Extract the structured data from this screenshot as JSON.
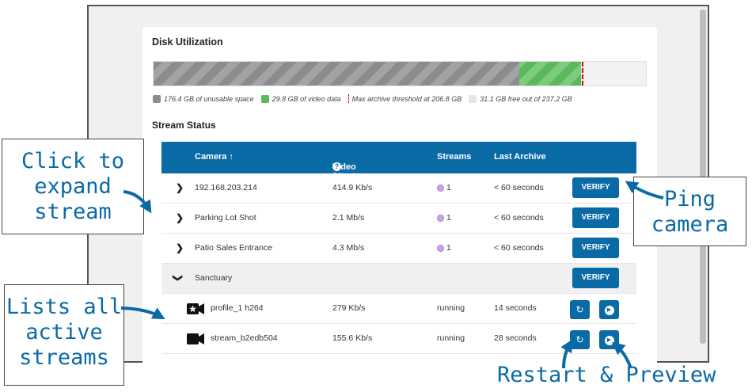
{
  "disk": {
    "title": "Disk Utilization",
    "unusable_fraction": 0.7425,
    "video_fraction": 0.1257,
    "threshold_fraction": 0.8696,
    "legend": {
      "unusable": "176.4 GB of unusable space",
      "video": "29.8 GB of video data",
      "threshold": "Max archive threshold at 206.8 GB",
      "free": "31.1 GB free out of 237.2 GB"
    },
    "colors": {
      "unusable": "#8c8c8c",
      "video": "#5cb85c",
      "threshold": "#d9001b",
      "free": "#e6e6e6"
    }
  },
  "stream_status": {
    "title": "Stream Status",
    "headers": {
      "camera": "Camera ↑",
      "bitrate": "Video Bitrate",
      "streams": "Streams",
      "archive": "Last Archive"
    },
    "help_icon": "❓",
    "rows": [
      {
        "chevron": "›",
        "camera": "192.168.203.214",
        "bitrate": "414.9 Kb/s",
        "streams": "1",
        "archive": "< 60 seconds",
        "action": "VERIFY"
      },
      {
        "chevron": "›",
        "camera": "Parking Lot Shot",
        "bitrate": "2.1 Mb/s",
        "streams": "1",
        "archive": "< 60 seconds",
        "action": "VERIFY"
      },
      {
        "chevron": "›",
        "camera": "Patio Sales Entrance",
        "bitrate": "4.3 Mb/s",
        "streams": "1",
        "archive": "< 60 seconds",
        "action": "VERIFY"
      },
      {
        "chevron": "⌄",
        "camera": "Sanctuary",
        "bitrate": "",
        "streams": "",
        "archive": "",
        "action": "VERIFY"
      }
    ],
    "substreams": [
      {
        "name": "profile_1 h264",
        "bitrate": "279 Kb/s",
        "status": "running",
        "archive": "14 seconds"
      },
      {
        "name": "stream_b2edb504",
        "bitrate": "155.6 Kb/s",
        "status": "running",
        "archive": "28 seconds"
      }
    ],
    "icons": {
      "restart": "↻",
      "preview": "▶"
    }
  },
  "callouts": {
    "expand": "Click to expand stream",
    "ping": "Ping camera",
    "lists": "Lists all active streams",
    "bottom": "Restart & Preview"
  },
  "accent": "#0a6aa6"
}
